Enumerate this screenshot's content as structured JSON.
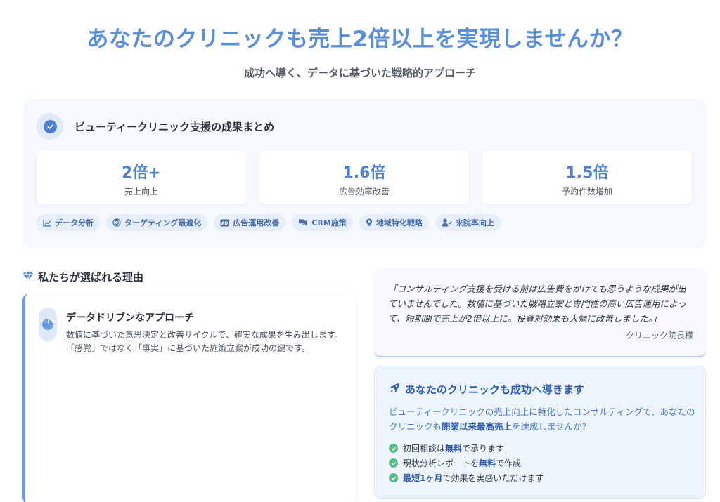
{
  "hero": {
    "title": "あなたのクリニックも売上2倍以上を実現しませんか？",
    "subtitle": "成功へ導く、データに基づいた戦略的アプローチ"
  },
  "summary": {
    "title": "ビューティークリニック支援の成果まとめ",
    "stats": [
      {
        "value": "2倍+",
        "label": "売上向上"
      },
      {
        "value": "1.6倍",
        "label": "広告効率改善"
      },
      {
        "value": "1.5倍",
        "label": "予約件数増加"
      }
    ],
    "tags": [
      {
        "label": "データ分析",
        "icon": "chart-line-icon"
      },
      {
        "label": "ターゲティング最適化",
        "icon": "target-icon"
      },
      {
        "label": "広告運用改善",
        "icon": "ad-icon"
      },
      {
        "label": "CRM施策",
        "icon": "chat-icon"
      },
      {
        "label": "地域特化戦略",
        "icon": "map-pin-icon"
      },
      {
        "label": "来院率向上",
        "icon": "user-check-icon"
      }
    ]
  },
  "why": {
    "heading": "私たちが選ばれる理由",
    "card": {
      "title": "データドリブンなアプローチ",
      "body": "数値に基づいた意思決定と改善サイクルで、確実な成果を生み出します。「感覚」ではなく「事実」に基づいた施策立案が成功の鍵です。"
    }
  },
  "testimonial": {
    "quote": "「コンサルティング支援を受ける前は広告費をかけても思うような成果が出ていませんでした。数値に基づいた戦略立案と専門性の高い広告運用によって、短期間で売上が2倍以上に。投資対効果も大幅に改善しました。」",
    "author": "- クリニック院長様"
  },
  "cta": {
    "title": "あなたのクリニックも成功へ導きます",
    "text_1": "ビューティークリニックの売上向上に特化したコンサルティングで、あなたのクリニックも",
    "text_bold": "開業以来最高売上",
    "text_2": "を達成しませんか？",
    "items": [
      {
        "pre": "初回相談は",
        "bold": "無料",
        "post": "で承ります"
      },
      {
        "pre": "現状分析レポートを",
        "bold": "無料",
        "post": "で作成"
      },
      {
        "pre": "",
        "bold": "最短1ヶ月",
        "post": "で効果を実感いただけます"
      }
    ]
  },
  "colors": {
    "accent": "#5b8ed8",
    "dark_accent": "#2f5fae",
    "check": "#5bb98a"
  }
}
